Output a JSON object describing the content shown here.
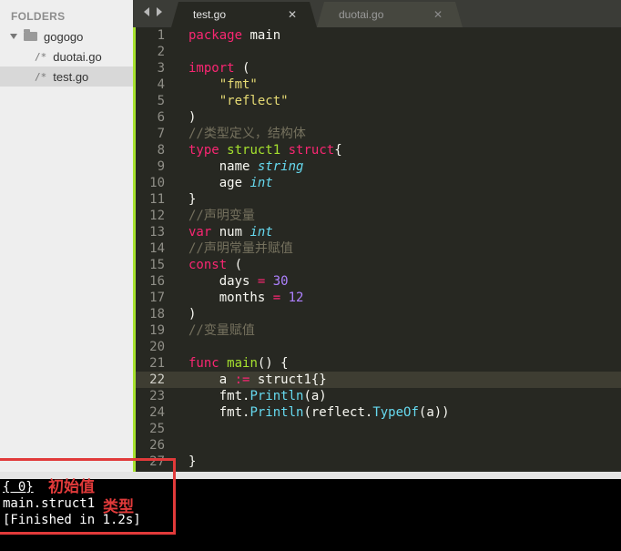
{
  "sidebar": {
    "header": "FOLDERS",
    "folder": "gogogo",
    "files": [
      {
        "icon": "/*",
        "name": "duotai.go",
        "selected": false
      },
      {
        "icon": "/*",
        "name": "test.go",
        "selected": true
      }
    ]
  },
  "tabs": [
    {
      "title": "test.go",
      "active": true,
      "close": "✕"
    },
    {
      "title": "duotai.go",
      "active": false,
      "close": "✕"
    }
  ],
  "editor": {
    "current_line": 22,
    "lines": [
      {
        "n": "1",
        "tokens": [
          [
            "kw",
            "package"
          ],
          [
            "plain",
            " main"
          ]
        ]
      },
      {
        "n": "2",
        "tokens": []
      },
      {
        "n": "3",
        "tokens": [
          [
            "kw",
            "import"
          ],
          [
            "plain",
            " ("
          ]
        ]
      },
      {
        "n": "4",
        "tokens": [
          [
            "plain",
            "    "
          ],
          [
            "str",
            "\"fmt\""
          ]
        ]
      },
      {
        "n": "5",
        "tokens": [
          [
            "plain",
            "    "
          ],
          [
            "str",
            "\"reflect\""
          ]
        ]
      },
      {
        "n": "6",
        "tokens": [
          [
            "plain",
            ")"
          ]
        ]
      },
      {
        "n": "7",
        "tokens": [
          [
            "cm",
            "//类型定义，结构体"
          ]
        ]
      },
      {
        "n": "8",
        "tokens": [
          [
            "kw",
            "type"
          ],
          [
            "plain",
            " "
          ],
          [
            "fn",
            "struct1"
          ],
          [
            "plain",
            " "
          ],
          [
            "kw",
            "struct"
          ],
          [
            "plain",
            "{"
          ]
        ]
      },
      {
        "n": "9",
        "tokens": [
          [
            "plain",
            "    name "
          ],
          [
            "typ",
            "string"
          ]
        ]
      },
      {
        "n": "10",
        "tokens": [
          [
            "plain",
            "    age "
          ],
          [
            "typ",
            "int"
          ]
        ]
      },
      {
        "n": "11",
        "tokens": [
          [
            "plain",
            "}"
          ]
        ]
      },
      {
        "n": "12",
        "tokens": [
          [
            "cm",
            "//声明变量"
          ]
        ]
      },
      {
        "n": "13",
        "tokens": [
          [
            "kw",
            "var"
          ],
          [
            "plain",
            " num "
          ],
          [
            "typ",
            "int"
          ]
        ]
      },
      {
        "n": "14",
        "tokens": [
          [
            "cm",
            "//声明常量并赋值"
          ]
        ]
      },
      {
        "n": "15",
        "tokens": [
          [
            "kw",
            "const"
          ],
          [
            "plain",
            " ("
          ]
        ]
      },
      {
        "n": "16",
        "tokens": [
          [
            "plain",
            "    days "
          ],
          [
            "kw",
            "="
          ],
          [
            "plain",
            " "
          ],
          [
            "num",
            "30"
          ]
        ]
      },
      {
        "n": "17",
        "tokens": [
          [
            "plain",
            "    months "
          ],
          [
            "kw",
            "="
          ],
          [
            "plain",
            " "
          ],
          [
            "num",
            "12"
          ]
        ]
      },
      {
        "n": "18",
        "tokens": [
          [
            "plain",
            ")"
          ]
        ]
      },
      {
        "n": "19",
        "tokens": [
          [
            "cm",
            "//变量赋值"
          ]
        ]
      },
      {
        "n": "20",
        "tokens": []
      },
      {
        "n": "21",
        "tokens": [
          [
            "kw",
            "func"
          ],
          [
            "plain",
            " "
          ],
          [
            "fn",
            "main"
          ],
          [
            "plain",
            "() {"
          ]
        ]
      },
      {
        "n": "22",
        "tokens": [
          [
            "plain",
            "    a "
          ],
          [
            "kw",
            ":="
          ],
          [
            "plain",
            " struct1{}"
          ]
        ]
      },
      {
        "n": "23",
        "tokens": [
          [
            "plain",
            "    fmt."
          ],
          [
            "call",
            "Println"
          ],
          [
            "plain",
            "(a)"
          ]
        ]
      },
      {
        "n": "24",
        "tokens": [
          [
            "plain",
            "    fmt."
          ],
          [
            "call",
            "Println"
          ],
          [
            "plain",
            "(reflect."
          ],
          [
            "call",
            "TypeOf"
          ],
          [
            "plain",
            "(a))"
          ]
        ]
      },
      {
        "n": "25",
        "tokens": []
      },
      {
        "n": "26",
        "tokens": []
      },
      {
        "n": "27",
        "tokens": [
          [
            "plain",
            "}"
          ]
        ]
      }
    ]
  },
  "output": {
    "line1": "{ 0}",
    "line2": "main.struct1",
    "line3": "[Finished in 1.2s]",
    "annotation_initial_value": "初始值",
    "annotation_type": "类型"
  },
  "colors": {
    "keyword": "#f92672",
    "function": "#a6e22e",
    "string": "#e6db74",
    "type": "#66d9ef",
    "number": "#ae81ff",
    "comment": "#75715e",
    "annotation": "#e13a3a"
  }
}
